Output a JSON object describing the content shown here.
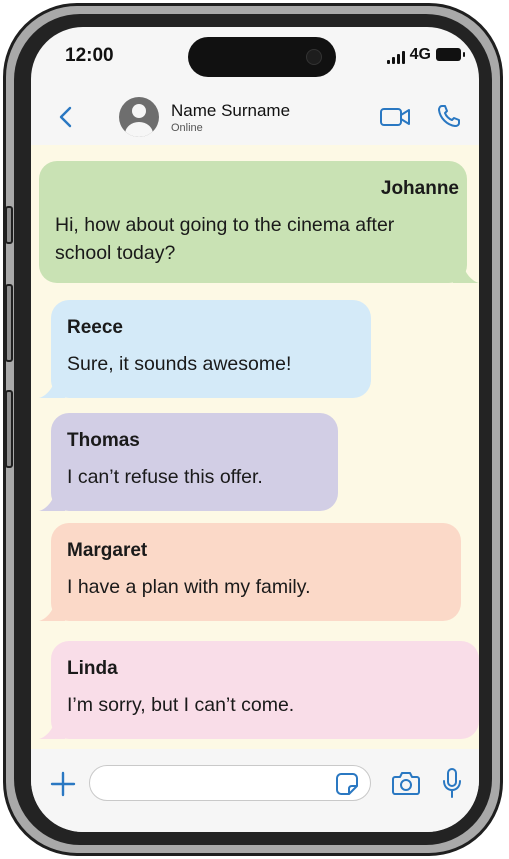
{
  "status_bar": {
    "time": "12:00",
    "network": "4G"
  },
  "header": {
    "contact_name": "Name Surname",
    "contact_status": "Online"
  },
  "messages": [
    {
      "sender": "Johanne",
      "text": "Hi, how about going to the cinema after school today?",
      "color": "#c9e2b4",
      "outgoing": true
    },
    {
      "sender": "Reece",
      "text": "Sure, it sounds awesome!",
      "color": "#d4eaf8",
      "outgoing": false
    },
    {
      "sender": "Thomas",
      "text": "I can’t refuse this offer.",
      "color": "#d2cee5",
      "outgoing": false
    },
    {
      "sender": "Margaret",
      "text": "I have a plan with my family.",
      "color": "#fbd9c8",
      "outgoing": false
    },
    {
      "sender": "Linda",
      "text": "I’m sorry, but I can’t come.",
      "color": "#f9dde8",
      "outgoing": false
    }
  ],
  "composer": {
    "value": "",
    "placeholder": ""
  },
  "theme": {
    "accent": "#2a78c2",
    "chat_background": "#fdf9e5"
  },
  "icons": {
    "back": "chevron-left-icon",
    "video": "video-camera-icon",
    "call": "phone-icon",
    "add": "plus-icon",
    "sticker": "sticker-icon",
    "camera": "camera-icon",
    "microphone": "microphone-icon"
  }
}
